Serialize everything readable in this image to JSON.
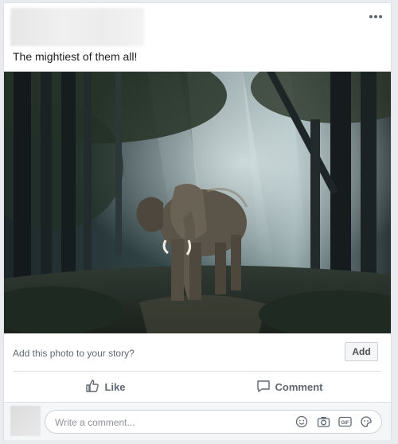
{
  "post": {
    "caption": "The mightiest of them all!",
    "more_icon": "more-options-icon",
    "photo_subject": "elephant-in-forest-photo"
  },
  "story": {
    "prompt": "Add this photo to your story?",
    "add_label": "Add"
  },
  "actions": {
    "like_label": "Like",
    "comment_label": "Comment"
  },
  "comment_box": {
    "placeholder": "Write a comment...",
    "icons": [
      "emoji-icon",
      "camera-icon",
      "gif-icon",
      "sticker-icon"
    ]
  },
  "colors": {
    "background": "#e9ebee",
    "card": "#ffffff",
    "text": "#1c1e21",
    "muted": "#606770",
    "border": "#dadde1"
  }
}
